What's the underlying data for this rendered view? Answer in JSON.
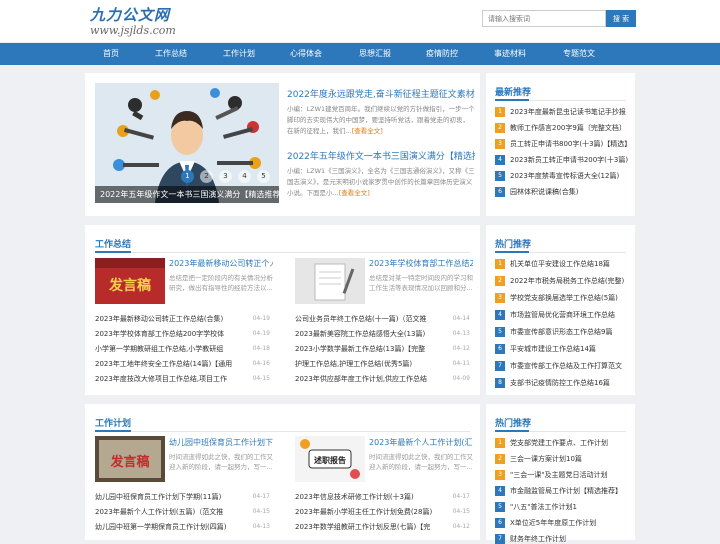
{
  "header": {
    "logo_title": "九力公文网",
    "logo_url": "www.jsjlds.com",
    "search_placeholder": "请输入搜索词",
    "search_button": "搜 索"
  },
  "nav": [
    "首页",
    "工作总结",
    "工作计划",
    "心得体会",
    "思想汇报",
    "疫情防控",
    "事迹材料",
    "专题范文"
  ],
  "featured": {
    "slides": [
      "1",
      "2",
      "3",
      "4",
      "5"
    ],
    "caption": "2022年五年级作文一本书三国演义满分【精选推荐】",
    "news": [
      {
        "title": "2022年度永远跟党走,奋斗新征程主题征文素材(全文完整)",
        "desc": "小编：LZW1建党百周年。我们继续以党的方针做指引，一步一个脚印的去实现伟大的中国梦，要坚持听党话，跟着党走的初衷，在新的征程上，我们...",
        "more": "[查看全文]"
      },
      {
        "title": "2022年五年级作文一本书三国演义满分【精选推荐】",
        "desc": "小编：LZW1《三国演义》，全名为《三国志通俗演义》，又称《三国志演义》，是元末明初小说家罗贯中创作的长篇章回体历史演义小说。下面是小...",
        "more": "[查看全文]"
      }
    ]
  },
  "recommend": {
    "title": "最新推荐",
    "items": [
      "2023年度最新昆虫记读书笔记手抄报",
      "教师工作感言200字9篇〔完整文档〕",
      "员工转正申请书800字(十3篇)【精选】",
      "2023新员工转正申请书200字(十3篇)",
      "2023年度禁毒宣传标语大全(12篇)",
      "园林体积说课稿(合集)"
    ]
  },
  "hot1": {
    "title": "热门推荐",
    "items": [
      "机关单位平安建设工作总结18篇",
      "2022年市税务局税务工作总结(完整)",
      "学校党支部换届选举工作总结(5篇)",
      "市场监管局优化营商环境工作总结",
      "市委宣传部意识形态工作总结9篇",
      "平安城市建设工作总结14篇",
      "市委宣传部工作总结及工作打算范文",
      "支部书记疫情防控工作总结16篇"
    ]
  },
  "hot2": {
    "title": "热门推荐",
    "items": [
      "党支部党建工作要点、工作计划",
      "三会一课方案计划10篇",
      "\"三会一课\"及主题党日活动计划",
      "市金融监管局工作计划【精选推荐】",
      "\"八五\"普法工作计划1",
      "X单位近5年年度原工作计划",
      "财务年终工作计划"
    ]
  },
  "summary": {
    "title": "工作总结",
    "cards": [
      {
        "thumb_text": "发言稿",
        "title": "2023年最新移动公司转正个人工作总结",
        "desc": "总结是把一定阶段内的有关情况分析研究，做出有指导性的经验方法以..."
      },
      {
        "thumb_text": "",
        "title": "2023年学校体育部工作总结200字",
        "desc": "总结是对某一特定时间段内的学习和工作生活等表现情况加以回顾和分..."
      }
    ],
    "left": [
      {
        "t": "2023年最新移动公司转正工作总结(合集)",
        "d": "04-19"
      },
      {
        "t": "2023年学校体育部工作总结200字学校体",
        "d": "04-19"
      },
      {
        "t": "小学第一学期教研组工作总结,小学教研组",
        "d": "04-18"
      },
      {
        "t": "2023年工地年终安全工作总结(14篇)【通用",
        "d": "04-16"
      },
      {
        "t": "2023年度技改大修项目工作总结,项目工作",
        "d": "04-15"
      }
    ],
    "right": [
      {
        "t": "公司业务员年终工作总结(十一篇)（范文推",
        "d": "04-14"
      },
      {
        "t": "2023最新美容院工作总结感悟大全(13篇)",
        "d": "04-13"
      },
      {
        "t": "2023小学数学最新工作总结(13篇)【完整",
        "d": "04-12"
      },
      {
        "t": "护理工作总结,护理工作总结(优秀5篇)",
        "d": "04-11"
      },
      {
        "t": "2023年供应部年度工作计划,供应工作总结",
        "d": "04-09"
      }
    ]
  },
  "plan": {
    "title": "工作计划",
    "cards": [
      {
        "thumb_text": "发言稿",
        "title": "幼儿园中班保育员工作计划下学期(11篇)",
        "desc": "时间流逝得如此之快，我们的工作又迎入新的阶段，请一起努力，写一..."
      },
      {
        "thumb_text": "述职报告",
        "title": "2023年最新个人工作计划(汇总16篇)",
        "desc": "时间流逝得如此之快，我们的工作又迎入新的阶段，请一起努力，写一..."
      }
    ],
    "left": [
      {
        "t": "幼儿园中班保育员工作计划下学期(11篇)",
        "d": "04-17"
      },
      {
        "t": "2023年最新个人工作计划(五篇)（范文推",
        "d": "04-15"
      },
      {
        "t": "幼儿园中班第一学期保育员工作计划(四篇)",
        "d": "04-13"
      }
    ],
    "right": [
      {
        "t": "2023年信息技术研修工作计划(十3篇)",
        "d": "04-17"
      },
      {
        "t": "2023年最新小学班主任工作计划免费(28篇)",
        "d": "04-15"
      },
      {
        "t": "2023年数学组教研工作计划反思(七篇)【完",
        "d": "04-12"
      }
    ]
  }
}
